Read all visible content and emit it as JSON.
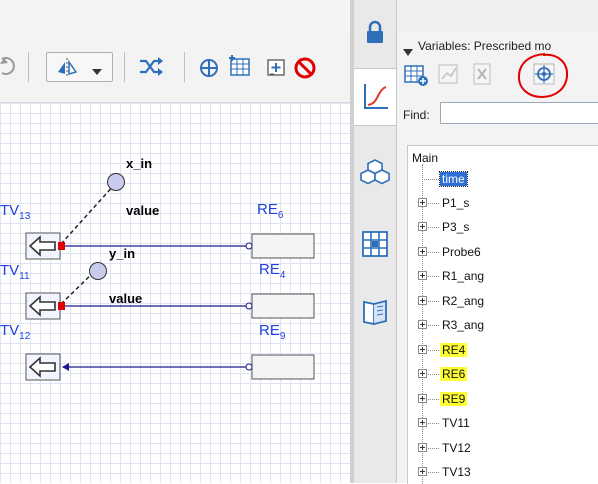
{
  "toolbar": {
    "buttons": [
      "refresh-icon",
      "flip-icon",
      "dropdown-arrow-icon",
      "shuffle-icon",
      "crosshair-icon",
      "table-icon",
      "plus-box-icon",
      "stop-icon"
    ]
  },
  "sidebar": {
    "items": [
      "lock-icon",
      "chart-icon",
      "cubes-icon",
      "grid-icon",
      "book-icon"
    ],
    "active": "chart-icon"
  },
  "panel": {
    "title": "Variables: Prescribed mo",
    "tools": [
      "add-variable-icon",
      "plot-icon",
      "delete-icon",
      "locate-icon"
    ],
    "find_label": "Find:",
    "find_value": "",
    "highlight_color": "#ff0000"
  },
  "tree": {
    "root": "Main",
    "items": [
      {
        "label": "time",
        "state": "selected",
        "expandable": false
      },
      {
        "label": "P1_s",
        "state": "normal",
        "expandable": true
      },
      {
        "label": "P3_s",
        "state": "normal",
        "expandable": true
      },
      {
        "label": "Probe6",
        "state": "normal",
        "expandable": true
      },
      {
        "label": "R1_ang",
        "state": "normal",
        "expandable": true
      },
      {
        "label": "R2_ang",
        "state": "normal",
        "expandable": true
      },
      {
        "label": "R3_ang",
        "state": "normal",
        "expandable": true
      },
      {
        "label": "RE4",
        "state": "highlighted",
        "expandable": true
      },
      {
        "label": "RE6",
        "state": "highlighted",
        "expandable": true
      },
      {
        "label": "RE9",
        "state": "highlighted",
        "expandable": true
      },
      {
        "label": "TV11",
        "state": "normal",
        "expandable": true
      },
      {
        "label": "TV12",
        "state": "normal",
        "expandable": true
      },
      {
        "label": "TV13",
        "state": "normal",
        "expandable": true
      }
    ]
  },
  "diagram": {
    "tv13": {
      "name": "TV",
      "sub": "13"
    },
    "tv11": {
      "name": "TV",
      "sub": "11"
    },
    "tv12": {
      "name": "TV",
      "sub": "12"
    },
    "re6": {
      "name": "RE",
      "sub": "6"
    },
    "re4": {
      "name": "RE",
      "sub": "4"
    },
    "re9": {
      "name": "RE",
      "sub": "9"
    },
    "x_in": "x_in",
    "y_in": "y_in",
    "value1": "value",
    "value2": "value",
    "colors": {
      "link": "#1a1a8c",
      "port": "#e00000",
      "block_border": "#555555",
      "label": "#1f3fdf",
      "node_fill": "#c8cbeb"
    }
  }
}
